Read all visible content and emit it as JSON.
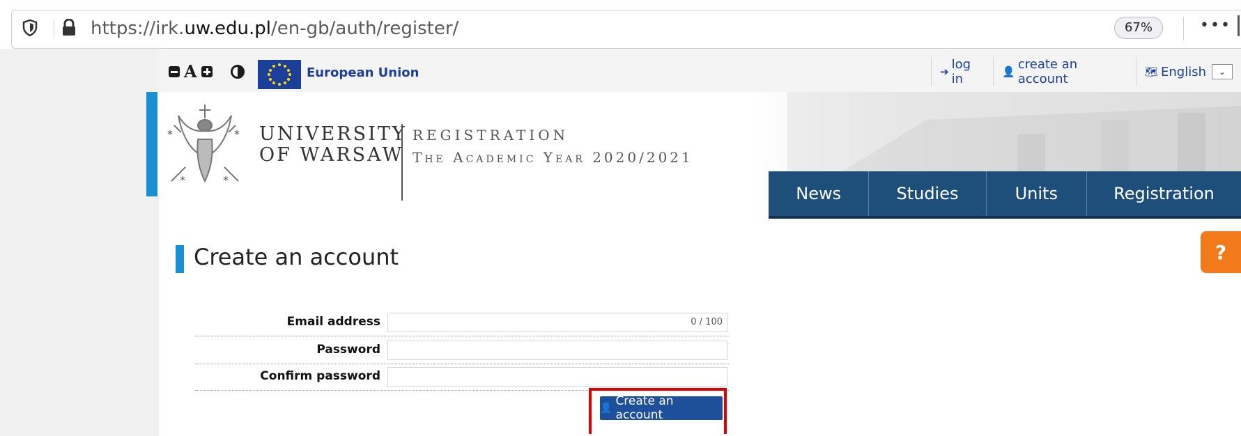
{
  "browser": {
    "url_prefix": "https://irk.",
    "url_domain": "uw.edu.pl",
    "url_path": "/en-gb/auth/register/",
    "zoom": "67%",
    "menu_dots": "•••"
  },
  "topbar": {
    "eu_label": "European Union",
    "login_label": "log in",
    "create_account_label": "create an account",
    "language_label": "English"
  },
  "header": {
    "university_line1": "UNIVERSITY",
    "university_line2": "OF WARSAW",
    "registration": "REGISTRATION",
    "academic_year": "The Academic Year 2020/2021"
  },
  "mainnav": {
    "items": [
      "News",
      "Studies",
      "Units",
      "Registration"
    ]
  },
  "help_label": "?",
  "page_title": "Create an account",
  "form": {
    "email_label": "Email address",
    "email_counter": "0 / 100",
    "password_label": "Password",
    "confirm_label": "Confirm password",
    "submit_label": "Create an account"
  },
  "colors": {
    "accent": "#1a8fd1",
    "nav": "#1e4f7a",
    "button": "#1e4f9a",
    "help": "#f27a1a",
    "highlight": "#e00000"
  }
}
